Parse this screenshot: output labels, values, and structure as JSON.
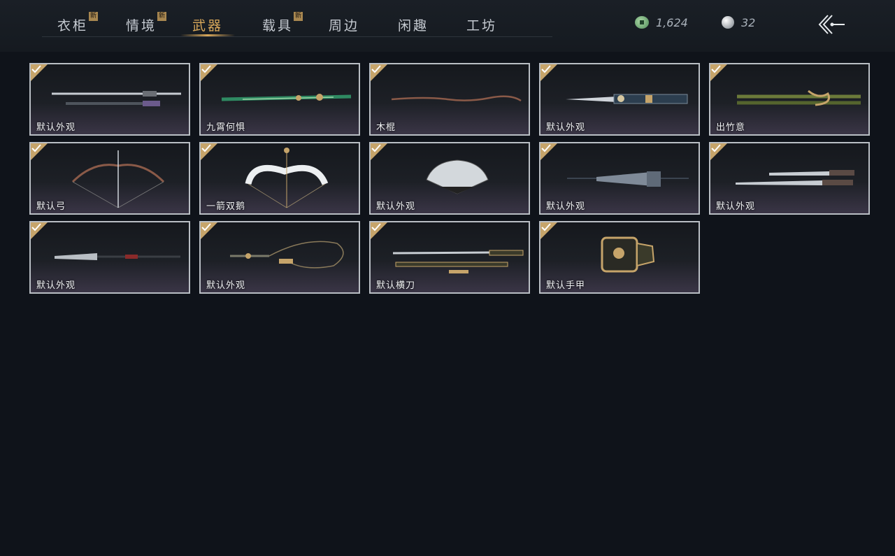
{
  "tabs": [
    {
      "label": "衣柜",
      "new": "新"
    },
    {
      "label": "情境",
      "new": "新"
    },
    {
      "label": "武器",
      "new": ""
    },
    {
      "label": "载具",
      "new": "新"
    },
    {
      "label": "周边",
      "new": ""
    },
    {
      "label": "闲趣",
      "new": ""
    },
    {
      "label": "工坊",
      "new": ""
    }
  ],
  "active_tab": "武器",
  "currency": {
    "jade_coin": "1,624",
    "pearl": "32",
    "jade_icon": "jade-coin-icon",
    "pearl_icon": "pearl-icon"
  },
  "back_icon": "back-arrow-icon",
  "items": [
    {
      "label": "默认外观",
      "icon": "spear-icon"
    },
    {
      "label": "九霄何惧",
      "icon": "jade-sword-icon"
    },
    {
      "label": "木棍",
      "icon": "wooden-staff-icon"
    },
    {
      "label": "默认外观",
      "icon": "ornate-sword-icon"
    },
    {
      "label": "出竹意",
      "icon": "bamboo-staff-icon"
    },
    {
      "label": "默认弓",
      "icon": "bow-icon"
    },
    {
      "label": "一箭双鹅",
      "icon": "goose-bow-icon"
    },
    {
      "label": "默认外观",
      "icon": "fan-icon"
    },
    {
      "label": "默认外观",
      "icon": "umbrella-icon"
    },
    {
      "label": "默认外观",
      "icon": "twin-blades-icon"
    },
    {
      "label": "默认外观",
      "icon": "glaive-icon"
    },
    {
      "label": "默认外观",
      "icon": "rope-dart-icon"
    },
    {
      "label": "默认横刀",
      "icon": "hengdao-icon"
    },
    {
      "label": "默认手甲",
      "icon": "gauntlet-icon"
    }
  ],
  "colors": {
    "background": "#0f131a",
    "accent": "#d9a85a",
    "card_border": "#b9bec4",
    "check_badge": "#c6a46a"
  }
}
